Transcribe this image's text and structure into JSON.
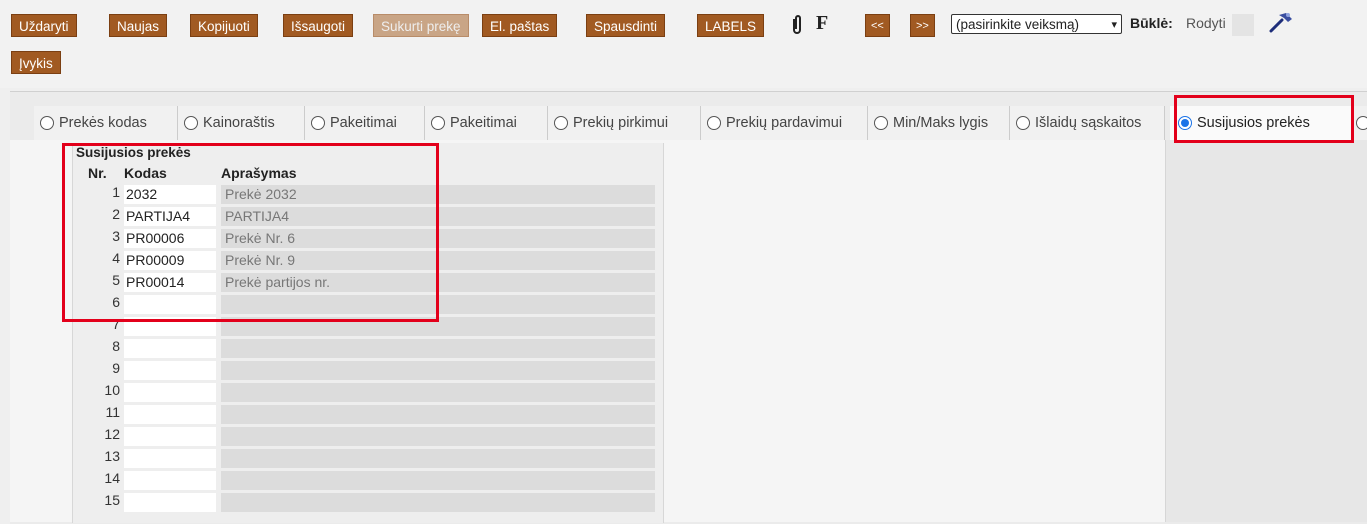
{
  "toolbar": {
    "buttons": [
      {
        "label": "Uždaryti"
      },
      {
        "label": "Naujas"
      },
      {
        "label": "Kopijuoti"
      },
      {
        "label": "Išsaugoti"
      },
      {
        "label": "Sukurti prekę"
      },
      {
        "label": "El. paštas"
      },
      {
        "label": "Spausdinti"
      },
      {
        "label": "LABELS"
      }
    ],
    "f_label": "F",
    "prev_label": "<<",
    "next_label": ">>",
    "action_select": "(pasirinkite veiksmą)",
    "status_label": "Būklė:",
    "status_value": "Rodyti",
    "event_button": "Įvykis",
    "icons": [
      "paperclip-icon",
      "hammer-icon"
    ]
  },
  "tabs": [
    {
      "label": "Prekės kodas",
      "selected": false
    },
    {
      "label": "Kainoraštis",
      "selected": false
    },
    {
      "label": "Pakeitimai",
      "selected": false
    },
    {
      "label": "Pakeitimai",
      "selected": false
    },
    {
      "label": "Prekių pirkimui",
      "selected": false
    },
    {
      "label": "Prekių pardavimui",
      "selected": false
    },
    {
      "label": "Min/Maks lygis",
      "selected": false
    },
    {
      "label": "Išlaidų sąskaitos",
      "selected": false
    },
    {
      "label": "Susijusios prekės",
      "selected": true
    }
  ],
  "grid": {
    "title": "Susijusios prekės",
    "columns": [
      "Nr.",
      "Kodas",
      "Aprašymas"
    ],
    "rows": [
      {
        "nr": "1",
        "code": "2032",
        "desc": "Prekė 2032"
      },
      {
        "nr": "2",
        "code": "PARTIJA4",
        "desc": "PARTIJA4"
      },
      {
        "nr": "3",
        "code": "PR00006",
        "desc": "Prekė Nr. 6"
      },
      {
        "nr": "4",
        "code": "PR00009",
        "desc": "Prekė Nr. 9"
      },
      {
        "nr": "5",
        "code": "PR00014",
        "desc": "Prekė partijos nr."
      },
      {
        "nr": "6",
        "code": "",
        "desc": ""
      },
      {
        "nr": "7",
        "code": "",
        "desc": ""
      },
      {
        "nr": "8",
        "code": "",
        "desc": ""
      },
      {
        "nr": "9",
        "code": "",
        "desc": ""
      },
      {
        "nr": "10",
        "code": "",
        "desc": ""
      },
      {
        "nr": "11",
        "code": "",
        "desc": ""
      },
      {
        "nr": "12",
        "code": "",
        "desc": ""
      },
      {
        "nr": "13",
        "code": "",
        "desc": ""
      },
      {
        "nr": "14",
        "code": "",
        "desc": ""
      },
      {
        "nr": "15",
        "code": "",
        "desc": ""
      }
    ]
  },
  "colors": {
    "button_bg": "#a15a22",
    "highlight": "#e3001b",
    "radio_accent": "#1a73e8"
  }
}
